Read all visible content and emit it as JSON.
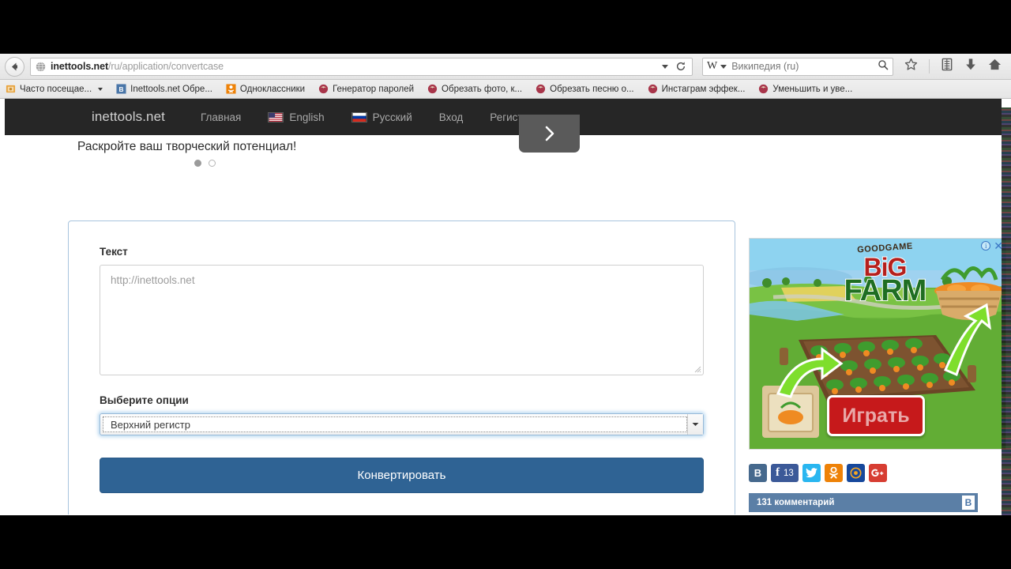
{
  "browser": {
    "back_label": "Back",
    "url_domain": "inettools.net",
    "url_path": "/ru/application/convertcase",
    "search_engine": "W",
    "search_placeholder": "Википедия (ru)",
    "icons": {
      "globe": "globe-icon",
      "reload": "reload-icon",
      "dropdown": "chevron-down-icon",
      "search": "search-icon",
      "bookmark": "star-icon",
      "reading_list": "reading-list-icon",
      "downloads": "download-icon",
      "home": "home-icon"
    },
    "bookmarks": [
      {
        "label": "Часто посещае...",
        "icon": "folder-icon",
        "has_arrow": true,
        "color": "#e8a33d"
      },
      {
        "label": "Inettools.net Обре...",
        "icon": "favicon-blue",
        "has_arrow": false,
        "color": "#4a76a8"
      },
      {
        "label": "Одноклассники",
        "icon": "favicon-ok",
        "has_arrow": false,
        "color": "#ee8208"
      },
      {
        "label": "Генератор паролей",
        "icon": "favicon-firefox",
        "has_arrow": false,
        "color": "#a8354a"
      },
      {
        "label": "Обрезать фото, к...",
        "icon": "favicon-firefox",
        "has_arrow": false,
        "color": "#a8354a"
      },
      {
        "label": "Обрезать песню о...",
        "icon": "favicon-firefox",
        "has_arrow": false,
        "color": "#a8354a"
      },
      {
        "label": "Инстаграм эффек...",
        "icon": "favicon-firefox",
        "has_arrow": false,
        "color": "#a8354a"
      },
      {
        "label": "Уменьшить и уве...",
        "icon": "favicon-firefox",
        "has_arrow": false,
        "color": "#a8354a"
      }
    ]
  },
  "site": {
    "brand": "inettools.net",
    "nav": [
      {
        "label": "Главная",
        "flag": null
      },
      {
        "label": "English",
        "flag": "us-flag-icon"
      },
      {
        "label": "Русский",
        "flag": "ru-flag-icon"
      },
      {
        "label": "Вход",
        "flag": null
      },
      {
        "label": "Регистрация",
        "flag": null
      }
    ],
    "slider": {
      "caption": "Раскройте ваш творческий потенциал!",
      "next_icon": "chevron-right-icon",
      "dots": 2,
      "active_dot": 0
    }
  },
  "form": {
    "text_label": "Текст",
    "text_placeholder": "http://inettools.net",
    "text_value": "",
    "options_label": "Выберите опции",
    "selected_option": "Верхний регистр",
    "submit_label": "Конвертировать",
    "dropdown_icon": "chevron-down-icon",
    "resize_icon": "resize-grip-icon"
  },
  "sidebar": {
    "ad": {
      "brand_top": "GOODGAME",
      "title_line1": "BiG",
      "title_line2": "FARM",
      "cta_label": "Играть",
      "info_icon": "info-icon",
      "close_icon": "close-icon"
    },
    "social": [
      {
        "name": "vk-share-button",
        "label": "B",
        "color": "#46698d",
        "count": null
      },
      {
        "name": "facebook-share-button",
        "label": "f",
        "color": "#3b5998",
        "count": "13"
      },
      {
        "name": "twitter-share-button",
        "label": "t",
        "color": "#29b6f0",
        "count": null
      },
      {
        "name": "odnoklassniki-share-button",
        "label": "ok",
        "color": "#ee8208",
        "count": null
      },
      {
        "name": "mailru-share-button",
        "label": "@",
        "color": "#16489c",
        "count": null
      },
      {
        "name": "googleplus-share-button",
        "label": "g+",
        "color": "#d73d32",
        "count": null
      }
    ],
    "comments": {
      "label": "131 комментарий",
      "badge": "B"
    }
  },
  "colors": {
    "navbar_bg": "#262626",
    "panel_border": "#a8c4dd",
    "button_bg": "#2f6394",
    "focus_glow": "#6eafe1",
    "comments_bg": "#5b7fa6"
  }
}
